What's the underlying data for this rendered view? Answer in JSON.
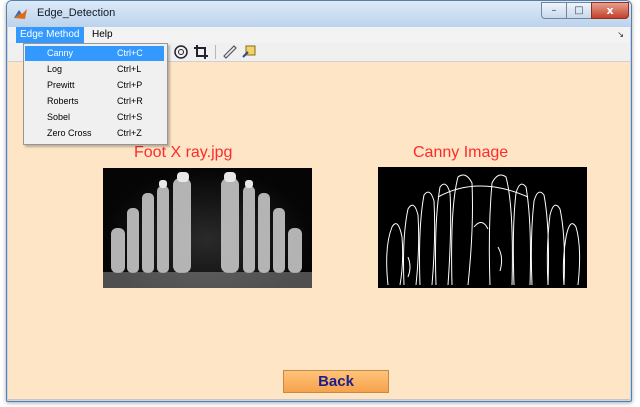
{
  "window": {
    "title": "Edge_Detection"
  },
  "titlebar_buttons": {
    "minimize": "–",
    "maximize": "□",
    "close": "x"
  },
  "menubar": {
    "edge_method": "Edge Method",
    "help": "Help",
    "collapse": "↘"
  },
  "toolbar": {
    "icons": [
      "zoom-icon",
      "crop-icon",
      "ruler-icon",
      "insert-icon"
    ]
  },
  "edge_menu": {
    "items": [
      {
        "label": "Canny",
        "shortcut": "Ctrl+C",
        "selected": true
      },
      {
        "label": "Log",
        "shortcut": "Ctrl+L",
        "selected": false
      },
      {
        "label": "Prewitt",
        "shortcut": "Ctrl+P",
        "selected": false
      },
      {
        "label": "Roberts",
        "shortcut": "Ctrl+R",
        "selected": false
      },
      {
        "label": "Sobel",
        "shortcut": "Ctrl+S",
        "selected": false
      },
      {
        "label": "Zero Cross",
        "shortcut": "Ctrl+Z",
        "selected": false
      }
    ]
  },
  "panel_left": {
    "caption": "Foot X ray.jpg"
  },
  "panel_right": {
    "caption": "Canny Image"
  },
  "back_button": {
    "label": "Back"
  },
  "colors": {
    "background": "#fde5c6",
    "caption": "#ff2b2b",
    "button": "#f7a24a",
    "selection": "#3399ff"
  }
}
